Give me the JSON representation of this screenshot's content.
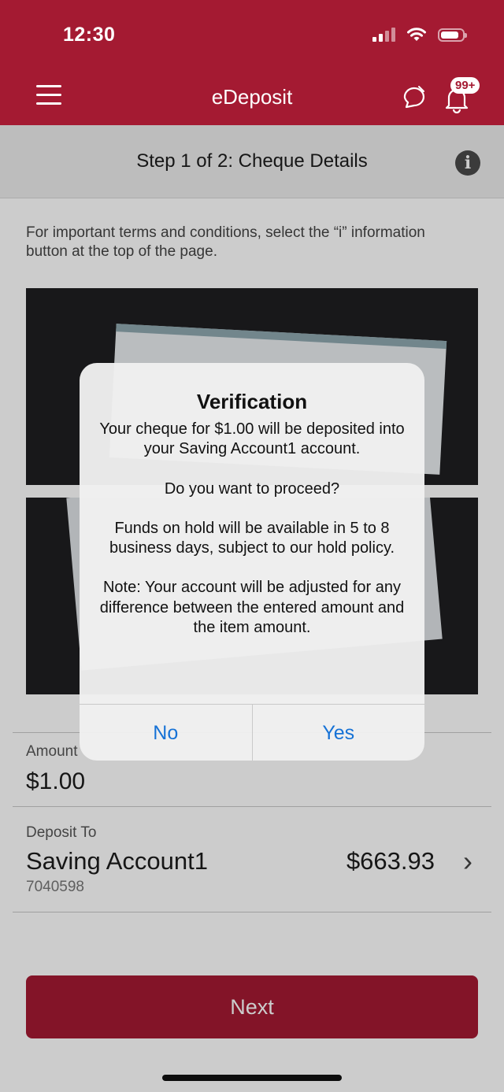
{
  "status_bar": {
    "time": "12:30"
  },
  "header": {
    "title": "eDeposit",
    "notification_badge": "99+",
    "brand_color": "#a41a32"
  },
  "step_bar": {
    "title": "Step 1 of 2: Cheque Details",
    "info_glyph": "i"
  },
  "terms_text": "For important terms and conditions, select the “i” information button at the top of the page.",
  "amount": {
    "label": "Amount",
    "value": "$1.00"
  },
  "deposit_to": {
    "label": "Deposit To",
    "account_name": "Saving Account1",
    "account_number": "7040598",
    "balance": "$663.93"
  },
  "next_label": "Next",
  "dialog": {
    "title": "Verification",
    "line1": "Your cheque for $1.00 will be deposited into your Saving Account1 account.",
    "line2": "Do you want to proceed?",
    "line3": "Funds on hold will be available in 5 to 8 business days, subject to our hold policy.",
    "line4": "Note: Your account will be adjusted for any difference between the entered amount and the item amount.",
    "no_label": "No",
    "yes_label": "Yes",
    "button_color": "#1672d6"
  }
}
